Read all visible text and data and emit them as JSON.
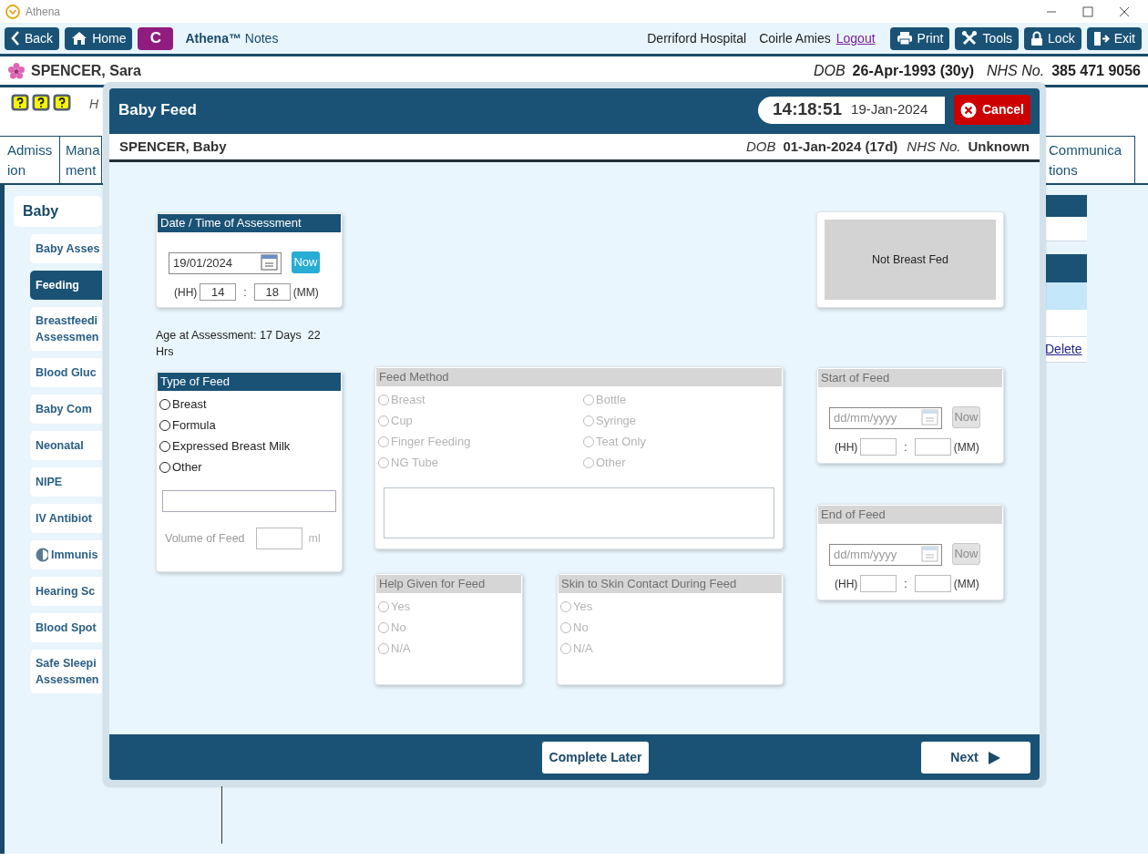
{
  "window": {
    "title": "Athena"
  },
  "toolbar": {
    "left_buttons": [
      {
        "kind": "back",
        "label": "Back"
      },
      {
        "kind": "home",
        "label": "Home"
      }
    ],
    "badge": "C",
    "app_name": "**Athena™** Notes",
    "location": "Derriford Hospital",
    "user": "Coirle Amies",
    "logout": "Logout",
    "right_buttons": [
      {
        "kind": "print",
        "label": "Print"
      },
      {
        "kind": "tools",
        "label": "Tools"
      },
      {
        "kind": "lock",
        "label": "Lock"
      },
      {
        "kind": "exit",
        "label": "Exit"
      }
    ]
  },
  "patient": {
    "name": "SPENCER, Sara",
    "dob_label": "DOB",
    "dob": "26-Apr-1993 (30y)",
    "nhs_label": "NHS No.",
    "nhs": "385 471 9056"
  },
  "info_text": "H",
  "tabs": [
    {
      "lines": [
        "Admiss",
        "ion"
      ],
      "selected": false
    },
    {
      "lines": [
        "Mana",
        "ment"
      ],
      "selected": false
    },
    {
      "lines": [
        "Communica",
        "tions"
      ],
      "selected": false
    }
  ],
  "sidebar": {
    "group": "Baby",
    "items": [
      {
        "lines": [
          "Baby Asses"
        ],
        "selected": false
      },
      {
        "lines": [
          "Feeding"
        ],
        "selected": true
      },
      {
        "lines": [
          "Breastfeedi",
          "Assessmen"
        ],
        "selected": false
      },
      {
        "lines": [
          "Blood Gluc"
        ],
        "selected": false
      },
      {
        "lines": [
          "Baby Com"
        ],
        "selected": false
      },
      {
        "lines": [
          "Neonatal"
        ],
        "selected": false
      },
      {
        "lines": [
          "NIPE"
        ],
        "selected": false
      },
      {
        "lines": [
          "IV Antibiot"
        ],
        "selected": false
      },
      {
        "lines": [
          "Immunis"
        ],
        "selected": false,
        "partial": true
      },
      {
        "lines": [
          "Hearing Sc"
        ],
        "selected": false
      },
      {
        "lines": [
          "Blood Spot"
        ],
        "selected": false
      },
      {
        "lines": [
          "Safe Sleepi",
          "Assessmen"
        ],
        "selected": false
      }
    ]
  },
  "side_panel": {
    "link": "Delete"
  },
  "dialog": {
    "title": "Baby Feed",
    "time": "14:18:51",
    "date": "19-Jan-2024",
    "cancel": "Cancel",
    "patient": {
      "name": "SPENCER, Baby",
      "dob_label": "DOB",
      "dob": "01-Jan-2024 (17d)",
      "nhs_label": "NHS No.",
      "nhs": "Unknown"
    },
    "assessment": {
      "title": "Date / Time of Assessment",
      "date": "19/01/2024",
      "now": "Now",
      "hh_label": "(HH)",
      "hh": "14",
      "separator": ":",
      "mm": "18",
      "mm_label": "(MM)"
    },
    "age": "Age at Assessment: 17 Days  22 Hrs",
    "type_of_feed": {
      "title": "Type of Feed",
      "disabled": false,
      "options": [
        {
          "label": "Breast",
          "selected": false
        },
        {
          "label": "Formula",
          "selected": false
        },
        {
          "label": "Expressed Breast Milk",
          "selected": false
        },
        {
          "label": "Other",
          "selected": false
        }
      ],
      "volume_label": "Volume of Feed",
      "volume_unit": "ml",
      "volume_disabled": true
    },
    "feed_method": {
      "title": "Feed Method",
      "disabled": true,
      "options": [
        {
          "label": "Breast",
          "selected": false
        },
        {
          "label": "Bottle",
          "selected": false
        },
        {
          "label": "Cup",
          "selected": false
        },
        {
          "label": "Syringe",
          "selected": false
        },
        {
          "label": "Finger Feeding",
          "selected": false
        },
        {
          "label": "Teat Only",
          "selected": false
        },
        {
          "label": "NG Tube",
          "selected": false
        },
        {
          "label": "Other",
          "selected": false
        }
      ]
    },
    "help_given": {
      "title": "Help Given for Feed",
      "disabled": true,
      "options": [
        {
          "label": "Yes",
          "selected": false
        },
        {
          "label": "No",
          "selected": false
        },
        {
          "label": "N/A",
          "selected": false
        }
      ]
    },
    "skin_to_skin": {
      "title": "Skin to Skin Contact During Feed",
      "disabled": true,
      "options": [
        {
          "label": "Yes",
          "selected": false
        },
        {
          "label": "No",
          "selected": false
        },
        {
          "label": "N/A",
          "selected": false
        }
      ]
    },
    "breast_status": "Not Breast Fed",
    "start_of_feed": {
      "title": "Start of Feed",
      "disabled": true,
      "date_placeholder": "dd/mm/yyyy",
      "now": "Now",
      "hh_label": "(HH)",
      "separator": ":",
      "mm_label": "(MM)"
    },
    "end_of_feed": {
      "title": "End of Feed",
      "disabled": true,
      "date_placeholder": "dd/mm/yyyy",
      "now": "Now",
      "hh_label": "(HH)",
      "separator": ":",
      "mm_label": "(MM)"
    },
    "footer": {
      "complete_later": "Complete Later",
      "next": "Next"
    }
  }
}
